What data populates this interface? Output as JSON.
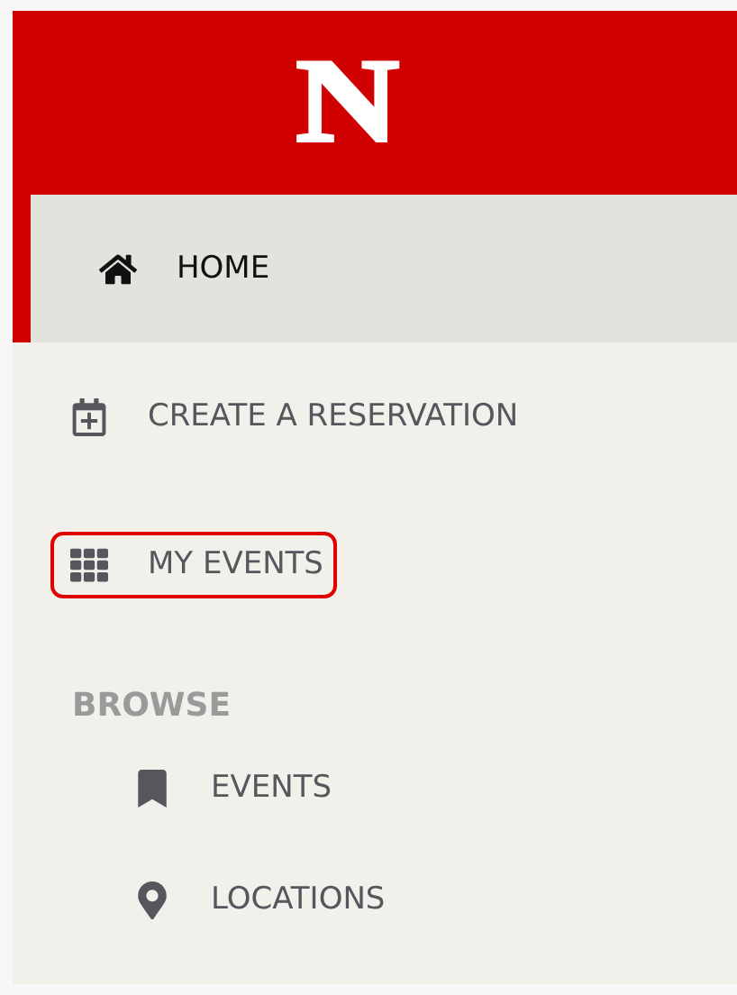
{
  "header": {
    "logo": "N"
  },
  "nav": [
    {
      "kind": "home",
      "label": "HOME",
      "selected": true,
      "highlighted": false
    },
    {
      "kind": "calendar",
      "label": "CREATE A RESERVATION",
      "selected": false,
      "highlighted": false
    },
    {
      "kind": "grid",
      "label": "MY EVENTS",
      "selected": false,
      "highlighted": true
    }
  ],
  "browse": {
    "heading": "BROWSE",
    "items": [
      {
        "kind": "bookmark",
        "label": "EVENTS",
        "selected": false
      },
      {
        "kind": "pin",
        "label": "LOCATIONS",
        "selected": false
      }
    ]
  }
}
